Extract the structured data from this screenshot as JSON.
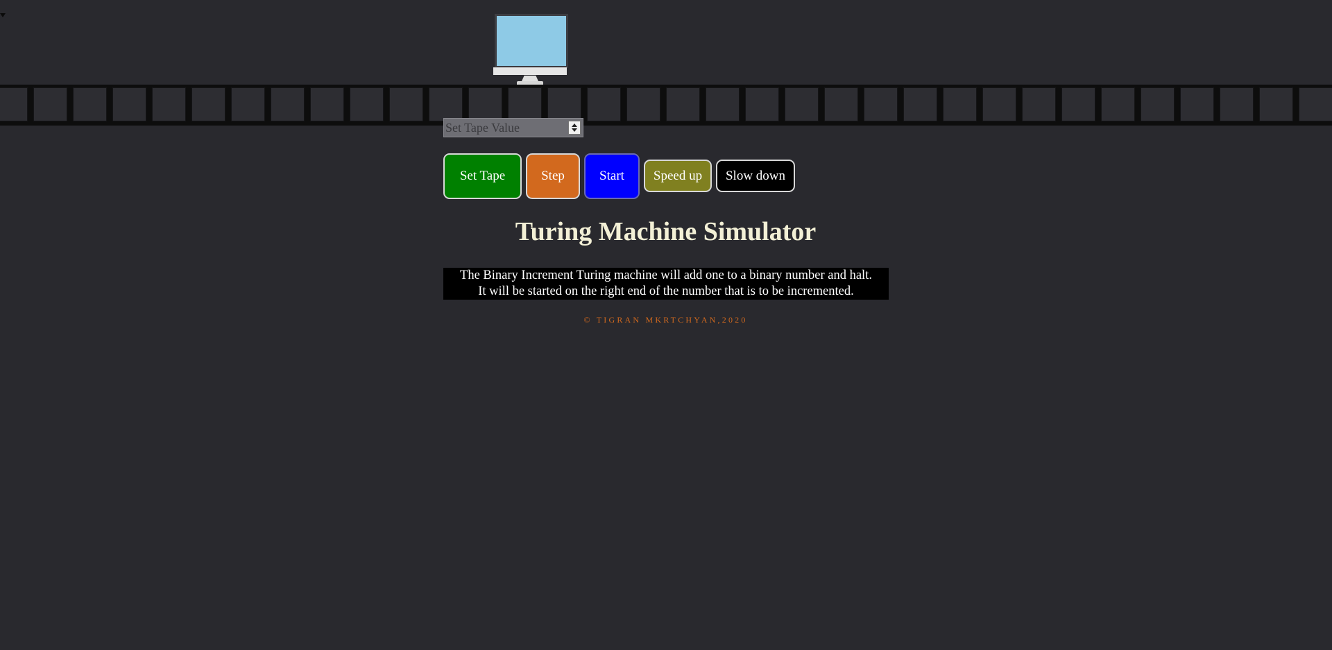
{
  "tape": {
    "cell_count": 35,
    "cells": []
  },
  "input": {
    "placeholder": "Set Tape Value",
    "value": ""
  },
  "buttons": {
    "set_tape": "Set Tape",
    "step": "Step",
    "start": "Start",
    "speed_up": "Speed up",
    "slow_down": "Slow down"
  },
  "title": "Turing Machine Simulator",
  "description": {
    "line1": "The Binary Increment Turing machine will add one to a binary number and halt.",
    "line2": "It will be started on the right end of the number that is to be incremented."
  },
  "footer": "© TIGRAN MKRTCHYAN,2020",
  "colors": {
    "background": "#29292e",
    "set_tape": "#008000",
    "step": "#d2691e",
    "start": "#0000ff",
    "speed_up": "#808020",
    "slow_down": "#000000",
    "title": "#f3f0d6",
    "footer": "#d2691e",
    "screen": "#8ecae6"
  },
  "icons": {
    "head": "monitor-icon",
    "spinner": "spinner-icon"
  }
}
